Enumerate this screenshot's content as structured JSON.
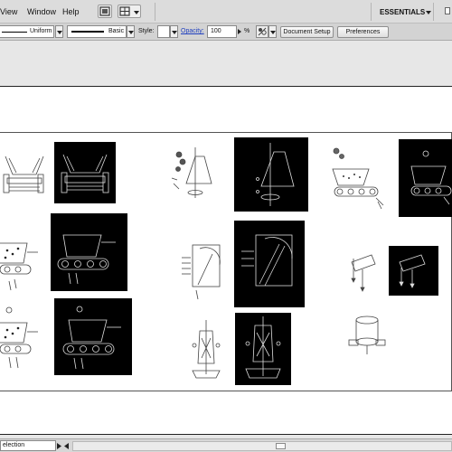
{
  "menubar": {
    "items": [
      "View",
      "Window",
      "Help"
    ],
    "workspace": "ESSENTIALS",
    "icons": [
      "bridge-icon",
      "arrange-documents-icon"
    ]
  },
  "controlbar": {
    "stroke_profile": "Uniform",
    "brush": "Basic",
    "style_label": "Style:",
    "opacity_label": "Opacity:",
    "opacity_value": "100",
    "opacity_unit": "%",
    "document_setup": "Document Setup",
    "preferences": "Preferences"
  },
  "statusbar": {
    "tool": "election"
  },
  "colors": {
    "chrome": "#dcdcdc",
    "canvas": "#ffffff",
    "link_blue": "#1f3fbf"
  }
}
